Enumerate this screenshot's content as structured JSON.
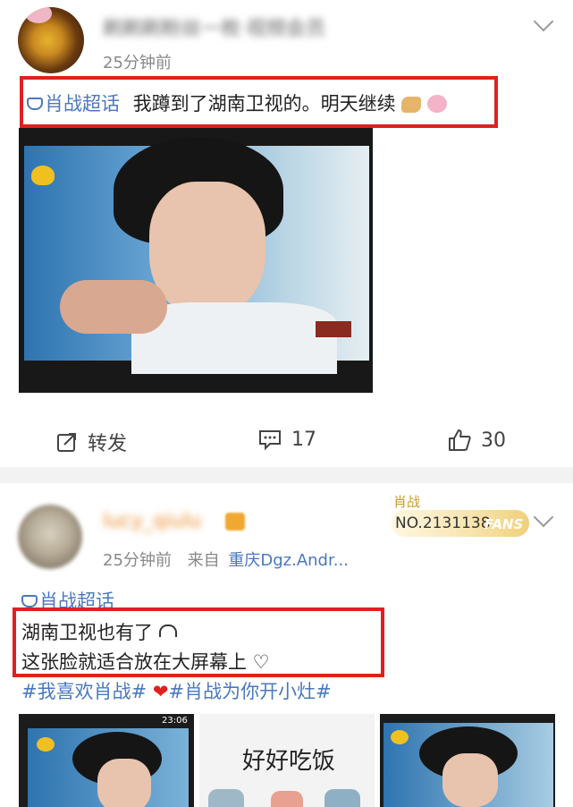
{
  "post1": {
    "username": "刷刷刷粉丝一枚·视频会员",
    "time": "25分钟前",
    "topic": "肖战超话",
    "text": "我蹲到了湖南卫视的。明天继续",
    "actions": {
      "repost": "转发",
      "comments": "17",
      "likes": "30"
    }
  },
  "post2": {
    "username": "lucy_qiulu",
    "time": "25分钟前",
    "source_prefix": "来自",
    "source": "重庆Dgz.Andr...",
    "badge": {
      "name": "肖战",
      "number": "NO.2131138",
      "fans": "FANS"
    },
    "topic": "肖战超话",
    "text_line1": "湖南卫视也有了",
    "text_line2": "这张脸就适合放在大屏幕上 ♡",
    "hashtag1": "#我喜欢肖战#",
    "hashtag2": "#肖战为你开小灶#",
    "thumb_time": "23:06",
    "thumb2_caption": "好好吃饭"
  },
  "colors": {
    "link": "#4a78bf",
    "highlight_box": "#e02020",
    "badge_gold": "#c99a2e"
  }
}
